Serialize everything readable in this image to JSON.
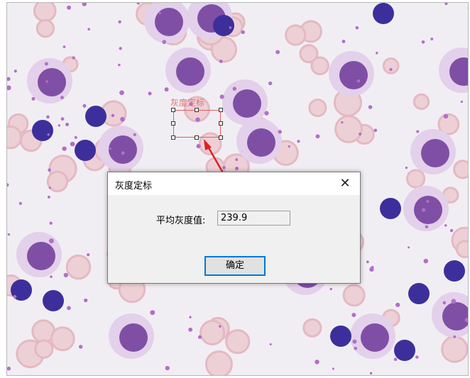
{
  "overlay": {
    "roi_label": "灰度定标"
  },
  "dialog": {
    "title": "灰度定标",
    "close_glyph": "✕",
    "field_label": "平均灰度值:",
    "field_value": "239.9",
    "ok_label": "确定"
  },
  "colors": {
    "roi_stroke": "#e06060",
    "arrow": "#e02020",
    "button_focus": "#0078d7"
  }
}
